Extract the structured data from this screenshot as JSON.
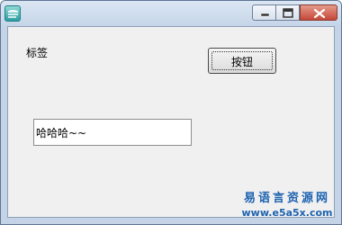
{
  "window": {
    "title": ""
  },
  "form": {
    "label_text": "标签",
    "button_label": "按钮",
    "input_value": "哈哈哈~~"
  },
  "watermark": {
    "title": "易语言资源网",
    "url": "www.e5a5x.com"
  },
  "icons": {
    "app": "app-logo-icon",
    "minimize": "minimize-icon",
    "maximize": "maximize-icon",
    "close": "close-icon"
  },
  "colors": {
    "titlebar": "#c5d5e8",
    "client_bg": "#f0f0f0",
    "close_button": "#c5473a",
    "watermark": "#1d62b0"
  }
}
